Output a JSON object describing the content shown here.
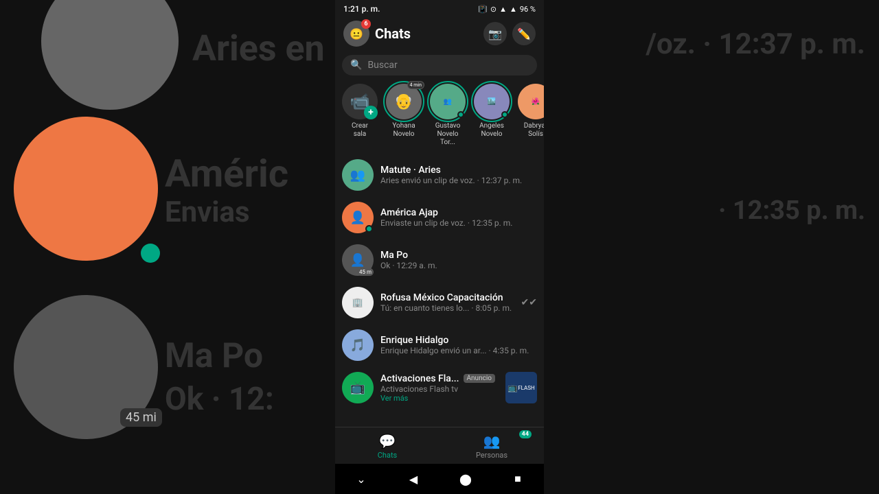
{
  "statusBar": {
    "time": "1:21 p. m.",
    "battery": "96 %",
    "batteryIcon": "🔋"
  },
  "header": {
    "title": "Chats",
    "notificationCount": "6",
    "cameraLabel": "📷",
    "editLabel": "✏️"
  },
  "search": {
    "placeholder": "Buscar"
  },
  "stories": [
    {
      "id": "crear-sala",
      "label": "Crear\nsala",
      "type": "create",
      "emoji": ""
    },
    {
      "id": "yohana",
      "label": "Yohana\nNovelo",
      "type": "story",
      "timerBadge": "4 min",
      "hasOnline": false,
      "bg": "#555"
    },
    {
      "id": "gustavo",
      "label": "Gustavo\nNovelo Tor...",
      "type": "story",
      "hasOnline": true,
      "bg": "#4a6",
      "timerBadge": null
    },
    {
      "id": "angeles",
      "label": "Angeles\nNovelo",
      "type": "story",
      "hasOnline": true,
      "bg": "#56a",
      "timerBadge": null
    },
    {
      "id": "dabryar",
      "label": "Dabryar\nSolís",
      "type": "story",
      "hasOnline": false,
      "bg": "#e85",
      "timerBadge": null
    }
  ],
  "chats": [
    {
      "id": "matute-aries",
      "name": "Matute · Aries",
      "preview": "Aries envió un clip de voz. · 12:37 p. m.",
      "time": "12:37 p. m.",
      "bg": "#5a7",
      "emoji": "👥",
      "hasOnline": false
    },
    {
      "id": "america-ajap",
      "name": "América Ajap",
      "preview": "Enviaste un clip de voz. · 12:35 p. m.",
      "time": "12:35 p. m.",
      "bg": "#e74",
      "emoji": "👤",
      "hasOnline": true
    },
    {
      "id": "ma-po",
      "name": "Ma Po",
      "preview": "Ok · 12:29 a. m.",
      "time": "12:29 a. m.",
      "bg": "#555",
      "emoji": "👤",
      "hasOnline": false,
      "timerBadge": "45 m"
    },
    {
      "id": "rofusa",
      "name": "Rofusa México Capacitación",
      "preview": "Tú: en cuanto tienes lo... · 8:05 p. m.",
      "time": "8:05 p. m.",
      "bg": "#ddd",
      "emoji": "🏢",
      "hasOnline": false,
      "hasCheck": true
    },
    {
      "id": "enrique-hidalgo",
      "name": "Enrique Hidalgo",
      "preview": "Enrique Hidalgo envió un ar... · 4:35 p. m.",
      "time": "4:35 p. m.",
      "bg": "#8ad",
      "emoji": "🎵",
      "hasOnline": false
    },
    {
      "id": "activaciones",
      "name": "Activaciones Fla...",
      "preview": "Activaciones Flash tv",
      "previewSub": "Ver más",
      "isAd": true,
      "adBadge": "Anuncio",
      "bg": "#1a5",
      "emoji": "📺"
    }
  ],
  "bottomNav": {
    "items": [
      {
        "id": "chats",
        "label": "Chats",
        "icon": "💬",
        "active": true
      },
      {
        "id": "personas",
        "label": "Personas",
        "icon": "👥",
        "active": false,
        "badge": "44"
      }
    ]
  },
  "systemNav": {
    "back": "◀",
    "home": "⬤",
    "recent": "■",
    "down": "⌄"
  },
  "background": {
    "topLeft": {
      "text": "Aries en",
      "subtext": "",
      "avatarBg": "#666"
    },
    "middleLeft": {
      "text": "Améric",
      "subtext": "Envias",
      "time": "· 12:35 p. m.",
      "avatarBg": "#e74"
    },
    "bottomLeft": {
      "text": "Ma Po",
      "subtext": "Ok · 12:",
      "avatarBg": "#555",
      "badge": "45 mi"
    }
  }
}
